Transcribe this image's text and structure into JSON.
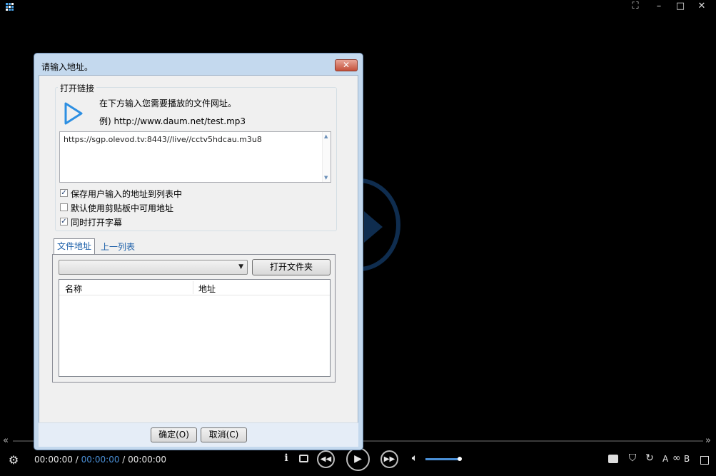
{
  "player": {
    "window_buttons": [
      "⛶",
      "–",
      "□",
      "✕"
    ],
    "time_current": "00:00:00",
    "time_separator_1": " / ",
    "time_ab": "00:00:00",
    "time_separator_2": " / ",
    "time_total": "00:00:00",
    "seek_back_label": "«",
    "seek_forward_label": "»",
    "right_controls": [
      "A",
      "∞",
      "B"
    ],
    "accent_color": "#4a8fd6"
  },
  "dialog": {
    "title": "请输入地址。",
    "close_label": "✕",
    "group_label": "打开链接",
    "hint_line1": "在下方输入您需要播放的文件网址。",
    "hint_line2": "例) http://www.daum.net/test.mp3",
    "url_value": "https://sgp.olevod.tv:8443//live//cctv5hdcau.m3u8",
    "checkboxes": [
      {
        "label": "保存用户输入的地址到列表中",
        "checked": true
      },
      {
        "label": "默认使用剪贴板中可用地址",
        "checked": false
      },
      {
        "label": "同时打开字幕",
        "checked": true
      }
    ],
    "tabs": [
      "文件地址",
      "上一列表"
    ],
    "combo_value": "",
    "open_folder_label": "打开文件夹",
    "list_columns": [
      "名称",
      "地址"
    ],
    "ok_label": "确定(O)",
    "cancel_label": "取消(C)"
  }
}
